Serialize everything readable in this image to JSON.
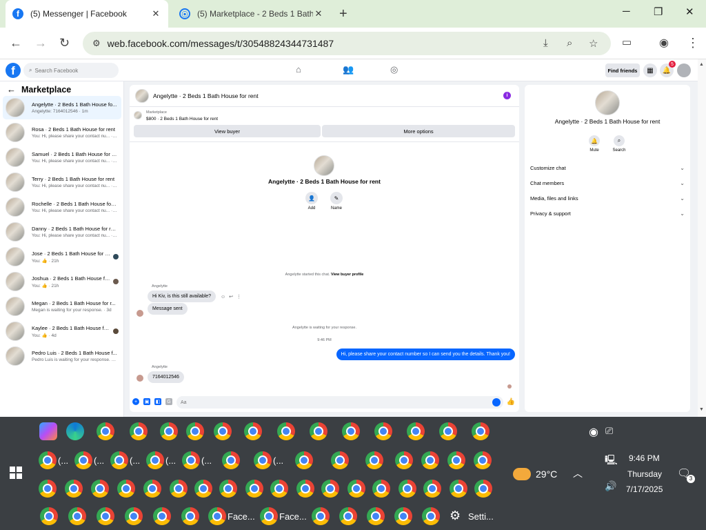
{
  "browser": {
    "tabs": [
      {
        "title": "(5) Messenger | Facebook",
        "active": true
      },
      {
        "title": "(5) Marketplace - 2 Beds 1 Bath",
        "active": false
      }
    ],
    "url": "web.facebook.com/messages/t/30548824344731487"
  },
  "facebook": {
    "search_placeholder": "Search Facebook",
    "find_friends": "Find friends",
    "notification_count": "5"
  },
  "sidebar": {
    "title": "Marketplace",
    "chats": [
      {
        "name": "Angelytte · 2 Beds 1 Bath House fo...",
        "preview": "Angelytte: 7164012546 · 1m",
        "selected": true
      },
      {
        "name": "Rosa · 2 Beds 1 Bath House for rent",
        "preview": "You: Hi, please share your contact nu... · 1m"
      },
      {
        "name": "Samuel · 2 Beds 1 Bath House for r...",
        "preview": "You: Hi, please share your contact nu... · 1m"
      },
      {
        "name": "Terry · 2 Beds 1 Bath House for rent",
        "preview": "You: Hi, please share your contact nu... · 1m"
      },
      {
        "name": "Rochelle · 2 Beds 1 Bath House for ...",
        "preview": "You: Hi, please share your contact nu... · 1m"
      },
      {
        "name": "Danny · 2 Beds 1 Bath House for re...",
        "preview": "You: Hi, please share your contact nu... · 1m"
      },
      {
        "name": "Jose · 2 Beds 1 Bath House for r...",
        "preview": "You: 👍 · 21h"
      },
      {
        "name": "Joshua · 2 Beds 1 Bath House fo...",
        "preview": "You: 👍 · 21h"
      },
      {
        "name": "Megan · 2 Beds 1 Bath House for r...",
        "preview": "Megan is waiting for your response. · 3d"
      },
      {
        "name": "Kaylee · 2 Beds 1 Bath House for...",
        "preview": "You: 👍 · 4d"
      },
      {
        "name": "Pedro Luis · 2 Beds 1 Bath House f...",
        "preview": "Pedro Luis is waiting for your response. · 5d"
      }
    ]
  },
  "chat": {
    "title": "Angelytte · 2 Beds 1 Bath House for rent",
    "listing_label": "Marketplace",
    "listing": "$800 · 2 Beds 1 Bath House for rent",
    "view_buyer": "View buyer",
    "more_options": "More options",
    "profile_name": "Angelytte · 2 Beds 1 Bath House for rent",
    "add_label": "Add",
    "name_label": "Name",
    "started_text": "Angelytte started this chat.",
    "view_buyer_profile": "View buyer profile",
    "sender_name": "Angelytte",
    "msg1": "Hi Kiv, is this still available?",
    "msg2": "Message sent",
    "waiting": "Angelytte is waiting for your response.",
    "time": "9:46 PM",
    "msg3": "Hi, please share your contact number so I can send you the details. Thank you!",
    "sender_name2": "Angelytte",
    "msg4": "7164012546",
    "composer_placeholder": "Aa"
  },
  "info_panel": {
    "name": "Angelytte · 2 Beds 1 Bath House for rent",
    "mute": "Mute",
    "search": "Search",
    "sections": [
      "Customize chat",
      "Chat members",
      "Media, files and links",
      "Privacy & support"
    ]
  },
  "taskbar": {
    "labels": [
      "Face...",
      "Face...",
      "Setti..."
    ],
    "group_labels": [
      "(...",
      "(...",
      "(...",
      "(...",
      "(...",
      "(..."
    ],
    "temperature": "29°C",
    "time": "9:46 PM",
    "day": "Thursday",
    "date": "7/17/2025",
    "notif_count": "3"
  }
}
